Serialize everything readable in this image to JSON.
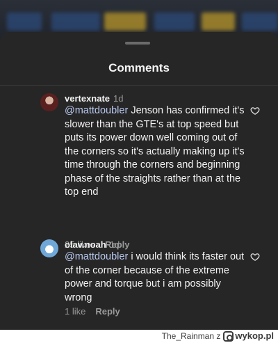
{
  "sheet": {
    "title": "Comments"
  },
  "comments": [
    {
      "username": "vertexnate",
      "time": "1d",
      "mention": "@mattdoubler",
      "text": " Jenson has confirmed it's slower than the GTE's at top speed but puts its power down well coming out of the corners so it's actually making up it's time through the corners and beginning phase of the straights rather than at the top end",
      "likes": "25 likes",
      "reply": "Reply"
    },
    {
      "username": "olav.noah",
      "time": "1d",
      "mention": "@mattdoubler",
      "text": " i would think its faster out of the corner because of the extreme power and torque but i am possibly wrong",
      "likes": "1 like",
      "reply": "Reply"
    }
  ],
  "watermark": {
    "author": "The_Rainman",
    "connector": "z",
    "site": "wykop.pl"
  },
  "icons": {
    "like": "heart-icon",
    "watermark_logo": "wykop-logo-icon"
  }
}
